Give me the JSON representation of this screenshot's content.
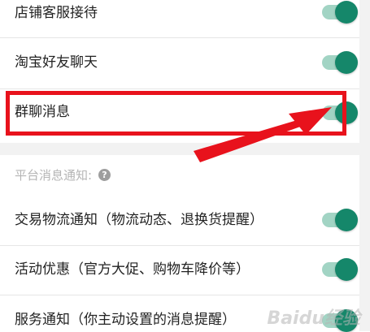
{
  "settings_top": [
    {
      "label": "店铺客服接待",
      "enabled": true
    },
    {
      "label": "淘宝好友聊天",
      "enabled": true
    },
    {
      "label": "群聊消息",
      "enabled": true
    }
  ],
  "platform_section": {
    "title": "平台消息通知:",
    "help_icon_glyph": "?",
    "items": [
      {
        "label": "交易物流通知（物流动态、退换货提醒）",
        "enabled": true
      },
      {
        "label": "活动优惠（官方大促、购物车降价等）",
        "enabled": true
      },
      {
        "label": "服务通知（你主动设置的消息提醒）",
        "enabled": true
      }
    ]
  },
  "watermark": "Baidu经验",
  "colors": {
    "toggle_track": "#a2d4c4",
    "toggle_knob": "#15876a",
    "highlight": "#e8121c",
    "section_title": "#b5b5b5"
  }
}
